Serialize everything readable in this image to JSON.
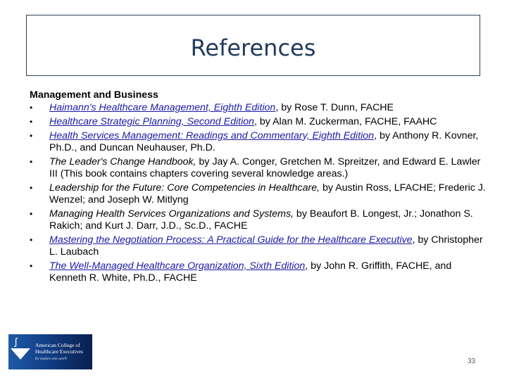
{
  "slide": {
    "title": "References",
    "section_heading": "Management and Business",
    "references": [
      {
        "title": "Haimann's Healthcare Management, Eighth Edition",
        "is_link": true,
        "rest": ", by Rose T. Dunn, FACHE"
      },
      {
        "title": "Healthcare Strategic Planning, Second Edition",
        "is_link": true,
        "rest": ", by Alan M. Zuckerman, FACHE, FAAHC"
      },
      {
        "title": "Health Services Management: Readings and Commentary, Eighth Edition",
        "is_link": true,
        "rest": ", by Anthony R. Kovner, Ph.D., and Duncan Neuhauser, Ph.D."
      },
      {
        "title": "The Leader's Change Handbook,",
        "is_link": false,
        "rest": " by Jay A. Conger, Gretchen M. Spreitzer, and Edward E. Lawler III (This book contains chapters covering several knowledge areas.)"
      },
      {
        "title": "Leadership for the Future: Core Competencies in Healthcare,",
        "is_link": false,
        "rest": " by Austin Ross, LFACHE; Frederic J. Wenzel; and Joseph W. Mitlyng"
      },
      {
        "title": "Managing Health Services Organizations and Systems,",
        "is_link": false,
        "rest": " by Beaufort B. Longest, Jr.; Jonathon S. Rakich; and Kurt J. Darr, J.D., Sc.D., FACHE"
      },
      {
        "title": "Mastering the Negotiation Process: A Practical Guide for the Healthcare Executive",
        "is_link": true,
        "rest": ", by Christopher L. Laubach"
      },
      {
        "title": "The Well-Managed Healthcare Organization, Sixth Edition",
        "is_link": true,
        "rest": ", by John R. Griffith, FACHE, and Kenneth R. White, Ph.D., FACHE"
      }
    ],
    "logo": {
      "line1": "American College of",
      "line2": "Healthcare Executives",
      "tagline": "for leaders who care®",
      "icon": "torch-flame-icon"
    },
    "page_number": "33"
  },
  "colors": {
    "title": "#1f3a5c",
    "title_border": "#2e3f4f",
    "link": "#1a1aa6",
    "logo_blue": "#123f86"
  }
}
